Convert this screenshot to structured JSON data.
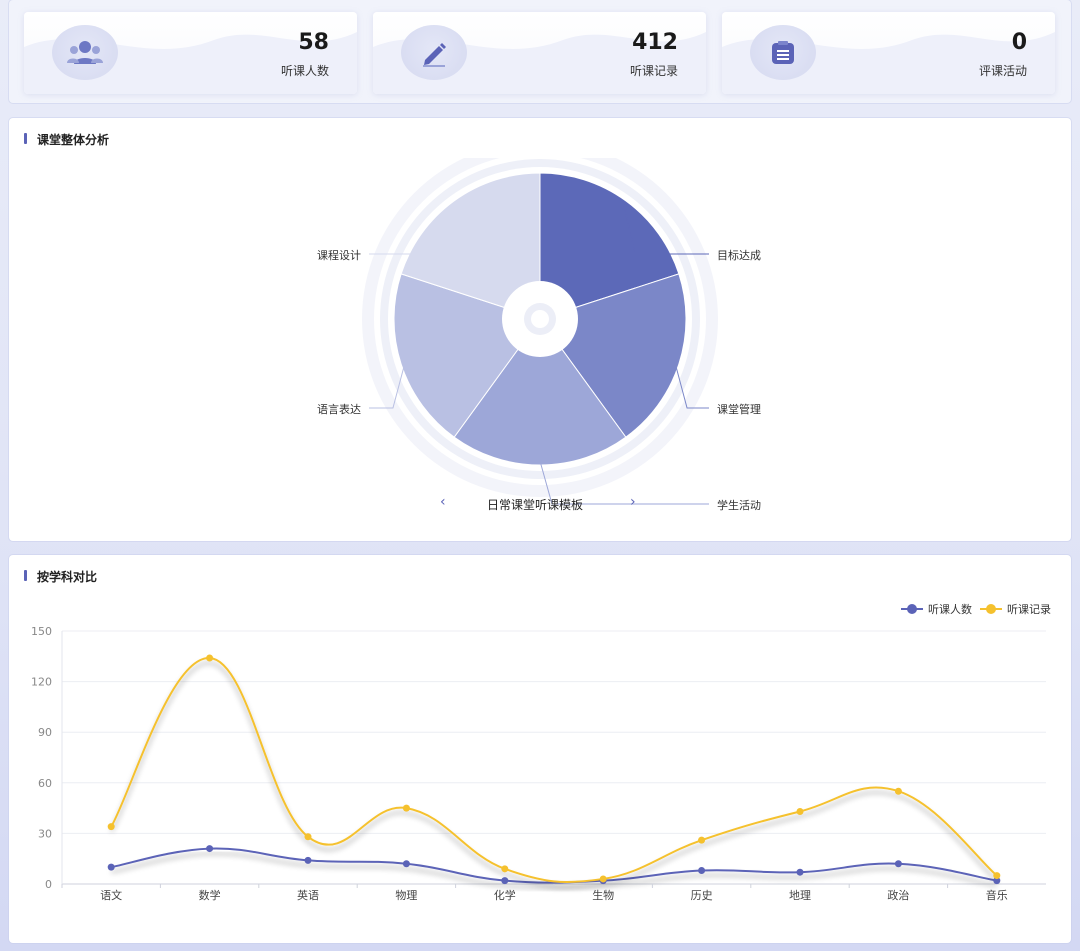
{
  "stats": [
    {
      "value": "58",
      "label": "听课人数",
      "icon": "users-icon"
    },
    {
      "value": "412",
      "label": "听课记录",
      "icon": "pencil-icon"
    },
    {
      "value": "0",
      "label": "评课活动",
      "icon": "clipboard-icon"
    }
  ],
  "pie_section": {
    "title": "课堂整体分析",
    "template_name": "日常课堂听课模板",
    "prev_label": "‹",
    "next_label": "›"
  },
  "line_section": {
    "title": "按学科对比"
  },
  "colors": {
    "accent": "#5b63b7",
    "series_people": "#5b63b7",
    "series_records": "#f5c12e",
    "pie": [
      "#5c69b8",
      "#7b87c8",
      "#9da7d8",
      "#b9c0e3",
      "#d6daee"
    ]
  },
  "chart_data": [
    {
      "type": "pie",
      "title": "",
      "labels": [
        "目标达成",
        "课堂管理",
        "学生活动",
        "语言表达",
        "课程设计"
      ],
      "values": [
        20,
        20,
        20,
        20,
        20
      ]
    },
    {
      "type": "line",
      "title": "",
      "categories": [
        "语文",
        "数学",
        "英语",
        "物理",
        "化学",
        "生物",
        "历史",
        "地理",
        "政治",
        "音乐"
      ],
      "series": [
        {
          "name": "听课人数",
          "values": [
            10,
            21,
            14,
            12,
            2,
            2,
            8,
            7,
            12,
            2
          ]
        },
        {
          "name": "听课记录",
          "values": [
            34,
            134,
            28,
            45,
            9,
            3,
            26,
            43,
            55,
            5
          ]
        }
      ],
      "ylim": [
        0,
        150
      ],
      "yticks": [
        0,
        30,
        60,
        90,
        120,
        150
      ],
      "grid": true,
      "legend_position": "top-right"
    }
  ]
}
